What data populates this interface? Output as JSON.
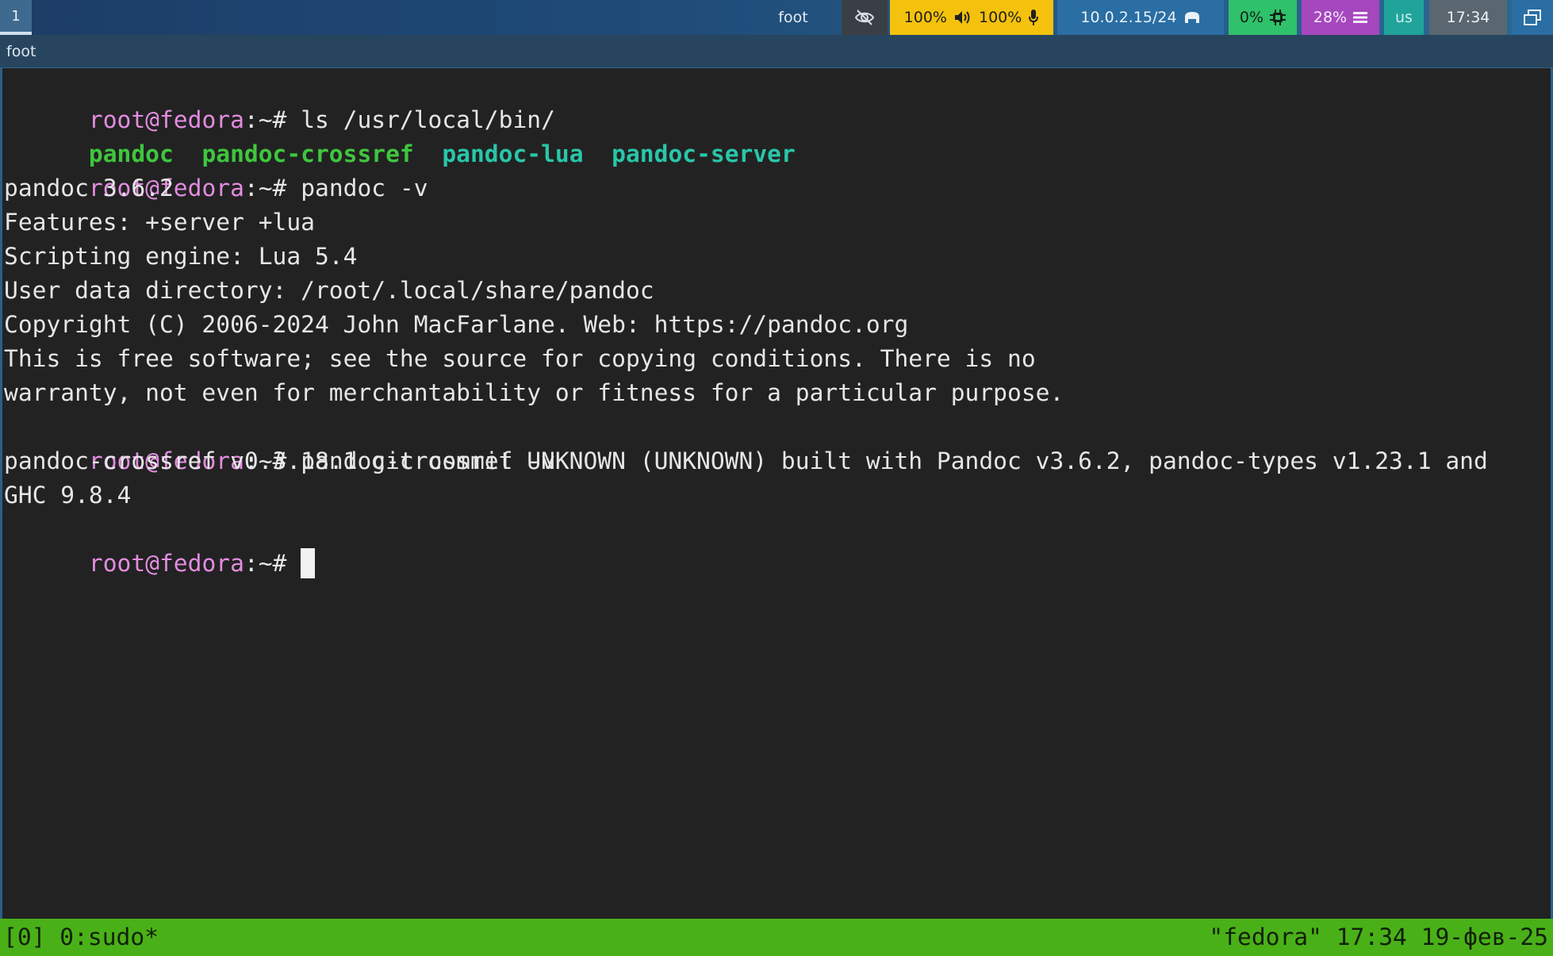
{
  "bar": {
    "workspace": "1",
    "title": "foot",
    "audio": {
      "output": "100%",
      "input": "100%"
    },
    "network": "10.0.2.15/24",
    "cpu": "0%",
    "memory": "28%",
    "layout": "us",
    "clock": "17:34",
    "colors": {
      "audio": "#f4c20d",
      "network": "#2a6ea3",
      "cpu": "#2fc16b",
      "memory": "#a547bd",
      "layout": "#20a39b"
    }
  },
  "window": {
    "title": "foot"
  },
  "terminal": {
    "prompt": {
      "user_host": "root@fedora",
      "path_symbol": ":~#"
    },
    "commands": {
      "ls": "ls /usr/local/bin/",
      "pandoc_v": "pandoc -v",
      "crossref_v": "pandoc-crossref -v"
    },
    "ls_output": [
      "pandoc",
      "pandoc-crossref",
      "pandoc-lua",
      "pandoc-server"
    ],
    "pandoc_output": [
      "pandoc 3.6.2",
      "Features: +server +lua",
      "Scripting engine: Lua 5.4",
      "User data directory: /root/.local/share/pandoc",
      "Copyright (C) 2006-2024 John MacFarlane. Web: https://pandoc.org",
      "This is free software; see the source for copying conditions. There is no",
      "warranty, not even for merchantability or fitness for a particular purpose."
    ],
    "crossref_output": [
      "pandoc-crossref v0.3.18.1 git commit UNKNOWN (UNKNOWN) built with Pandoc v3.6.2, pandoc-types v1.23.1 and",
      "GHC 9.8.4"
    ]
  },
  "tmux": {
    "left": "[0] 0:sudo*",
    "right": "\"fedora\" 17:34 19-фев-25"
  }
}
